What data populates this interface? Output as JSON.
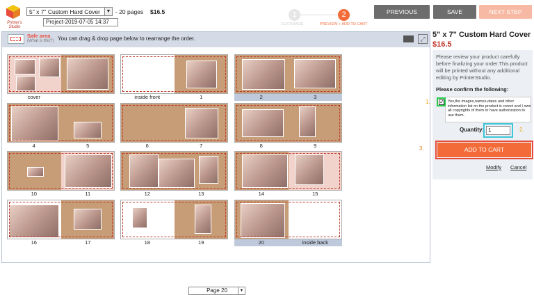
{
  "header": {
    "logo_text": "Printer's Studio",
    "product_select": "5\" x 7\" Custom Hard Cover",
    "pages_text": "- 20 pages",
    "price": "$16.5",
    "project_name": "Project-2019-07-05 14:37",
    "steps": [
      {
        "number": "1",
        "label": "CUSTOMIZE"
      },
      {
        "number": "2",
        "label": "PREVIEW + ADD TO CART"
      }
    ],
    "buttons": {
      "previous": "PREVIOUS",
      "save": "SAVE",
      "next": "NEXT STEP"
    }
  },
  "toolbar": {
    "safe_area": "Safe area",
    "what_is_this": "(What is this?)",
    "instruction": "You can drag & drop page below to rearrange the order."
  },
  "spreads": [
    {
      "left": "cover",
      "right": ""
    },
    {
      "left": "inside front",
      "right": "1"
    },
    {
      "left": "2",
      "right": "3"
    },
    {
      "left": "4",
      "right": "5"
    },
    {
      "left": "6",
      "right": "7"
    },
    {
      "left": "8",
      "right": "9"
    },
    {
      "left": "10",
      "right": "11"
    },
    {
      "left": "12",
      "right": "13"
    },
    {
      "left": "14",
      "right": "15"
    },
    {
      "left": "16",
      "right": "17"
    },
    {
      "left": "18",
      "right": "19"
    },
    {
      "left": "20",
      "right": "inside back"
    }
  ],
  "pager": {
    "value": "Page 20"
  },
  "panel": {
    "title": "5\" x 7\" Custom Hard Cover",
    "price": "$16.5",
    "review": "Please review your product carefully before finalizing your order.This product will be printed without any additional editing by PrinterStudio.",
    "confirm": "Please confirm the following:",
    "agree": "Yes,the images,names,dates and other information list on the product is corect and I own all copyrights of them or have authorization to use them.",
    "quantity_label": "Quantity:",
    "quantity_value": "1",
    "add_to_cart": "ADD TO CART",
    "modify": "Modify",
    "cancel": "Cancel",
    "markers": [
      "1.",
      "2.",
      "3."
    ]
  },
  "colors": {
    "accent": "#f26b38",
    "price": "#c0392b",
    "check_highlight": "#26c94a",
    "qty_highlight": "#3ec6d9",
    "cart_highlight": "#e74c3c"
  }
}
